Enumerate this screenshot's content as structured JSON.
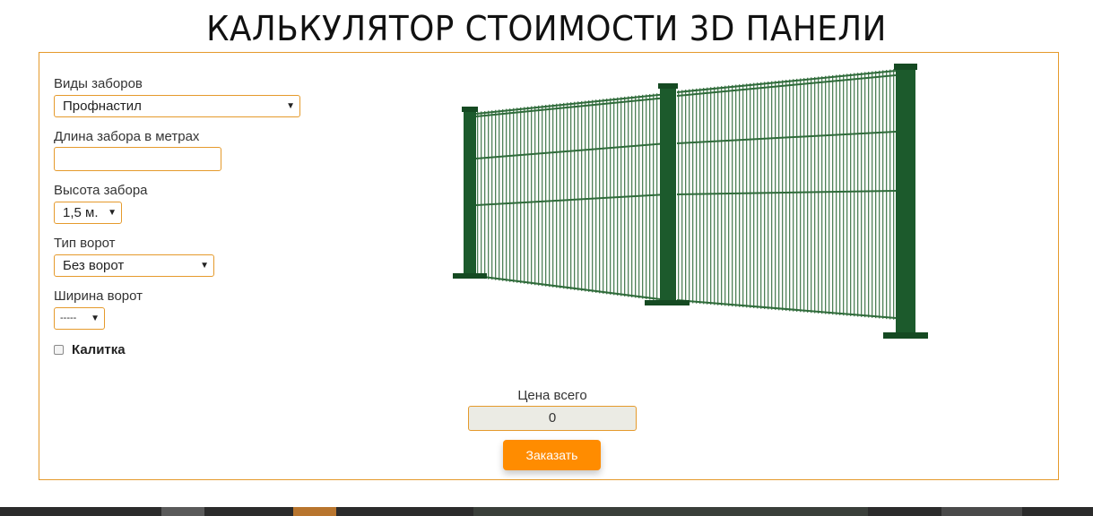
{
  "page": {
    "title": "КАЛЬКУЛЯТОР СТОИМОСТИ 3D ПАНЕЛИ"
  },
  "form": {
    "fence_type": {
      "label": "Виды заборов",
      "selected": "Профнастил"
    },
    "fence_length": {
      "label": "Длина забора в метрах",
      "value": "",
      "placeholder": ""
    },
    "fence_height": {
      "label": "Высота забора",
      "selected": "1,5 м."
    },
    "gate_type": {
      "label": "Тип ворот",
      "selected": "Без ворот"
    },
    "gate_width": {
      "label": "Ширина ворот",
      "selected": "-----"
    },
    "wicket": {
      "label": "Калитка",
      "checked": false
    }
  },
  "price": {
    "label": "Цена всего",
    "value": "0"
  },
  "order_button": {
    "label": "Заказать"
  },
  "colors": {
    "accent_border": "#e59a2c",
    "button": "#ff8c00",
    "fence_green": "#1c5a2c"
  },
  "icons": {
    "select_caret": "caret-down-icon",
    "fence_image": "fence-3d-panel-image"
  }
}
